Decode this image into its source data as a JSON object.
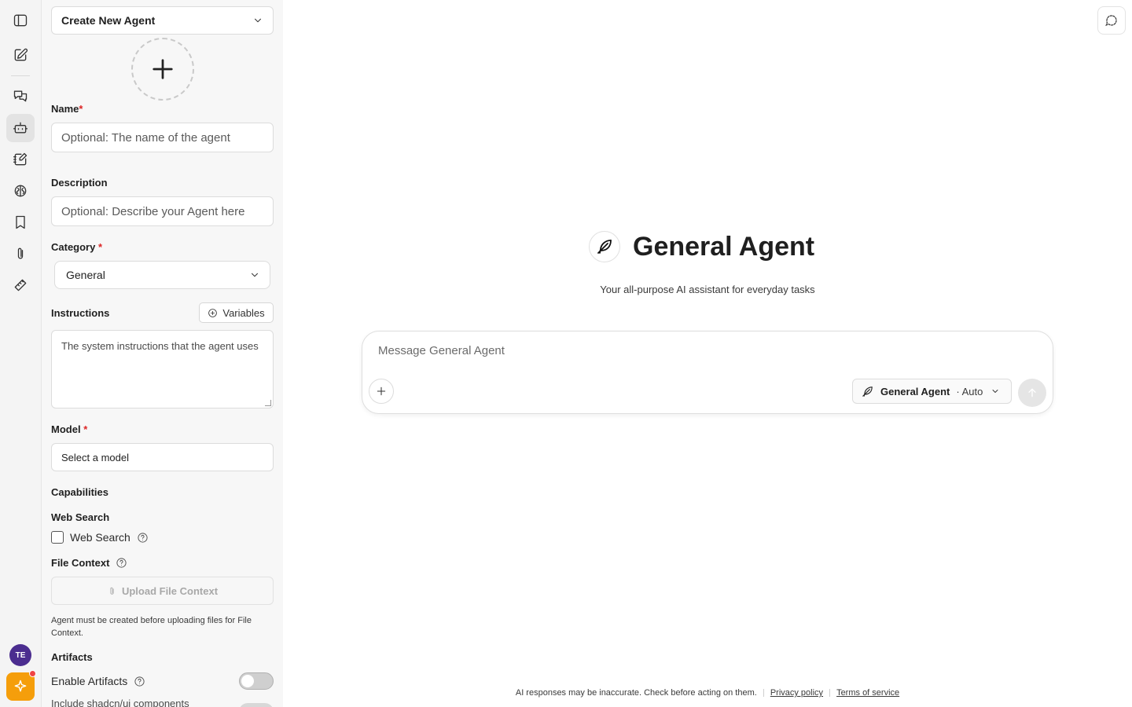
{
  "agent_builder": {
    "agent_select_label": "Create New Agent",
    "name_label": "Name",
    "name_required": "*",
    "name_placeholder": "Optional: The name of the agent",
    "description_label": "Description",
    "description_placeholder": "Optional: Describe your Agent here",
    "category_label": "Category",
    "category_required": "*",
    "category_value": "General",
    "instructions_label": "Instructions",
    "variables_button": "Variables",
    "instructions_placeholder": "The system instructions that the agent uses",
    "model_label": "Model",
    "model_required": "*",
    "model_placeholder": "Select a model",
    "capabilities_label": "Capabilities",
    "web_search_heading": "Web Search",
    "web_search_checkbox": "Web Search",
    "file_context_label": "File Context",
    "upload_button": "Upload File Context",
    "file_context_note": "Agent must be created before uploading files for File Context.",
    "artifacts_label": "Artifacts",
    "enable_artifacts": "Enable Artifacts",
    "shadcn_label": "Include shadcn/ui components"
  },
  "rail": {
    "avatar_initials": "TE"
  },
  "main": {
    "agent_title": "General Agent",
    "agent_subtitle": "Your all-purpose AI assistant for everyday tasks",
    "message_placeholder": "Message General Agent",
    "pill_agent_name": "General Agent",
    "pill_mode": "· Auto"
  },
  "footer": {
    "disclaimer": "AI responses may be inaccurate. Check before acting on them.",
    "privacy": "Privacy policy",
    "terms": "Terms of service"
  }
}
